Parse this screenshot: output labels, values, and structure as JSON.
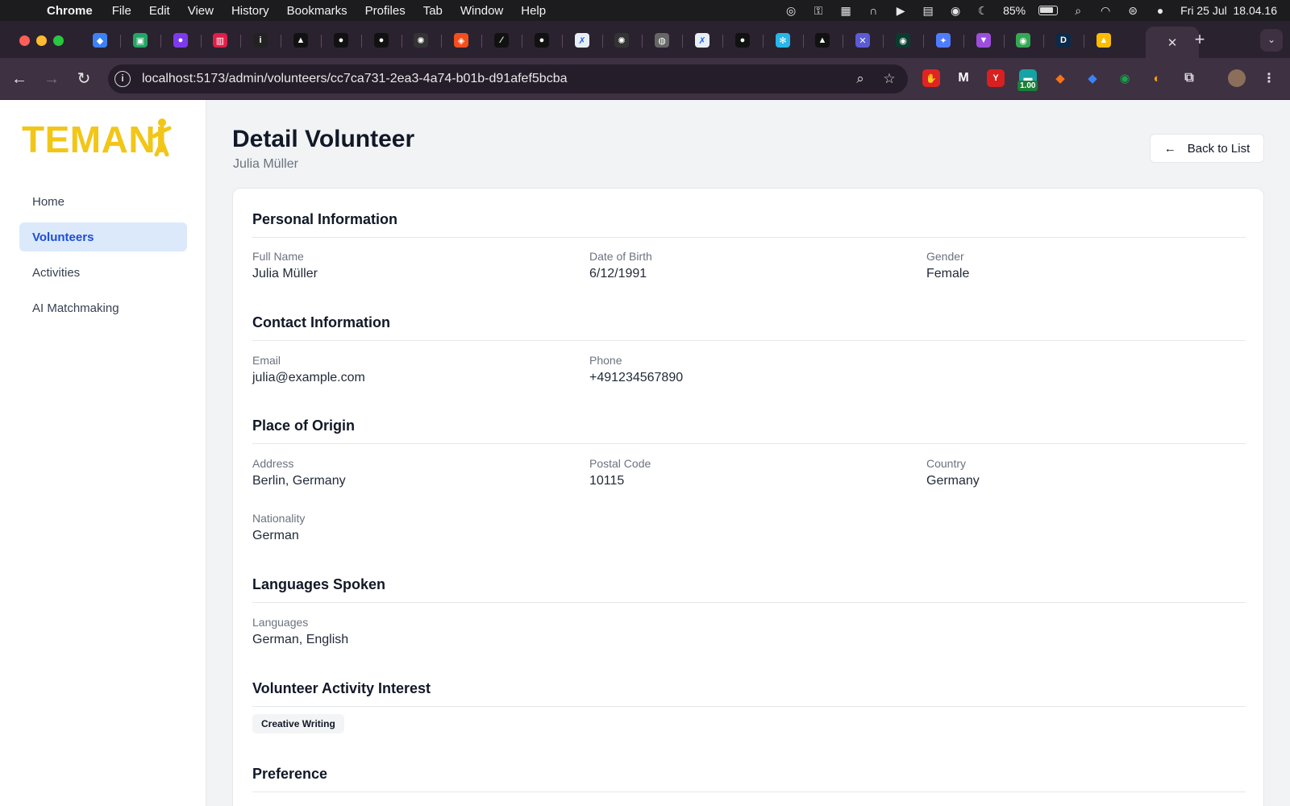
{
  "os_menubar": {
    "app_name": "Chrome",
    "menus": [
      "File",
      "Edit",
      "View",
      "History",
      "Bookmarks",
      "Profiles",
      "Tab",
      "Window",
      "Help"
    ],
    "battery_percent": "85%",
    "datetime": "Fri 25 Jul  18.04.16"
  },
  "browser": {
    "url": "localhost:5173/admin/volunteers/cc7ca731-2ea3-4a74-b01b-d91afef5bcba",
    "extension_badge": "1.00",
    "active_tab_close": "✕",
    "new_tab": "+",
    "tab_favicons": [
      {
        "icon": "gem-icon",
        "color": "#3b82f6",
        "glyph": "◆"
      },
      {
        "icon": "meet-icon",
        "color": "#22a565",
        "glyph": "▣"
      },
      {
        "icon": "chat-app-icon",
        "color": "#7c3aed",
        "glyph": "●"
      },
      {
        "icon": "toggle-app-icon",
        "color": "#e11d48",
        "glyph": "▥"
      },
      {
        "icon": "dev-icon",
        "color": "#222222",
        "glyph": "i"
      },
      {
        "icon": "vercel-icon",
        "color": "#111111",
        "glyph": "▲"
      },
      {
        "icon": "github-icon",
        "color": "#111111",
        "glyph": "●"
      },
      {
        "icon": "github-icon",
        "color": "#111111",
        "glyph": "●"
      },
      {
        "icon": "chatgpt-icon",
        "color": "#333333",
        "glyph": "✺"
      },
      {
        "icon": "figma-icon",
        "color": "#f24e1e",
        "glyph": "◈"
      },
      {
        "icon": "linear-icon",
        "color": "#111111",
        "glyph": "⁄"
      },
      {
        "icon": "github-icon",
        "color": "#111111",
        "glyph": "●"
      },
      {
        "icon": "temani-icon",
        "color": "#e8eef5",
        "glyph": "✗"
      },
      {
        "icon": "chatgpt-icon",
        "color": "#333333",
        "glyph": "✺"
      },
      {
        "icon": "globe-icon",
        "color": "#666666",
        "glyph": "◍"
      },
      {
        "icon": "temani-icon",
        "color": "#e8eef5",
        "glyph": "✗"
      },
      {
        "icon": "github-icon",
        "color": "#111111",
        "glyph": "●"
      },
      {
        "icon": "snowflake-icon",
        "color": "#29b5e8",
        "glyph": "✻"
      },
      {
        "icon": "vercel-icon",
        "color": "#111111",
        "glyph": "▲"
      },
      {
        "icon": "tools-icon",
        "color": "#5b5bd6",
        "glyph": "✕"
      },
      {
        "icon": "eye-icon",
        "color": "#0b3b2e",
        "glyph": "◉"
      },
      {
        "icon": "gemini-icon",
        "color": "#4f7cff",
        "glyph": "✦"
      },
      {
        "icon": "vite-icon",
        "color": "#9d4edd",
        "glyph": "▼"
      },
      {
        "icon": "maps-icon",
        "color": "#34a853",
        "glyph": "◉"
      },
      {
        "icon": "d-app-icon",
        "color": "#0b2a4a",
        "glyph": "D"
      },
      {
        "icon": "drive-icon",
        "color": "#fbbc04",
        "glyph": "▲"
      }
    ]
  },
  "sidebar": {
    "logo": "TEMANI",
    "items": [
      {
        "label": "Home",
        "active": false
      },
      {
        "label": "Volunteers",
        "active": true
      },
      {
        "label": "Activities",
        "active": false
      },
      {
        "label": "AI Matchmaking",
        "active": false
      }
    ]
  },
  "header": {
    "title": "Detail Volunteer",
    "subtitle": "Julia Müller",
    "back_label": "Back to List"
  },
  "sections": {
    "personal": {
      "title": "Personal Information",
      "full_name_label": "Full Name",
      "full_name": "Julia Müller",
      "dob_label": "Date of Birth",
      "dob": "6/12/1991",
      "gender_label": "Gender",
      "gender": "Female"
    },
    "contact": {
      "title": "Contact Information",
      "email_label": "Email",
      "email": "julia@example.com",
      "phone_label": "Phone",
      "phone": "+491234567890"
    },
    "origin": {
      "title": "Place of Origin",
      "address_label": "Address",
      "address": "Berlin, Germany",
      "postal_label": "Postal Code",
      "postal": "10115",
      "country_label": "Country",
      "country": "Germany",
      "nationality_label": "Nationality",
      "nationality": "German"
    },
    "languages": {
      "title": "Languages Spoken",
      "languages_label": "Languages",
      "languages": "German, English"
    },
    "interest": {
      "title": "Volunteer Activity Interest",
      "tags": [
        "Creative Writing"
      ]
    },
    "preference": {
      "title": "Preference"
    }
  }
}
